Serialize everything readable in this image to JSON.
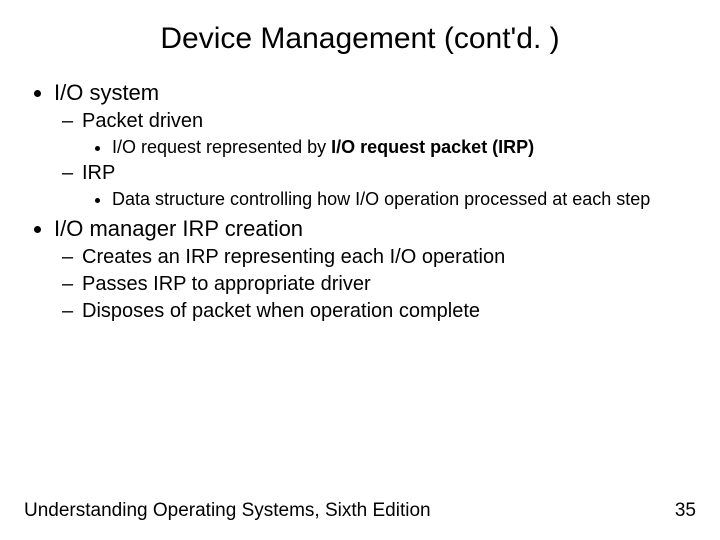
{
  "title": "Device Management (cont'd. )",
  "b1": "I/O system",
  "b1s1": "Packet driven",
  "b1s1d1_pre": "I/O request represented by ",
  "b1s1d1_bold": "I/O request packet (IRP)",
  "b1s2": "IRP",
  "b1s2d1": "Data structure controlling how I/O operation processed at each step",
  "b2": "I/O manager IRP creation",
  "b2s1": "Creates an IRP representing each I/O operation",
  "b2s2": "Passes IRP to appropriate driver",
  "b2s3": "Disposes of packet when operation complete",
  "footer_left": "Understanding Operating Systems, Sixth Edition",
  "footer_right": "35"
}
